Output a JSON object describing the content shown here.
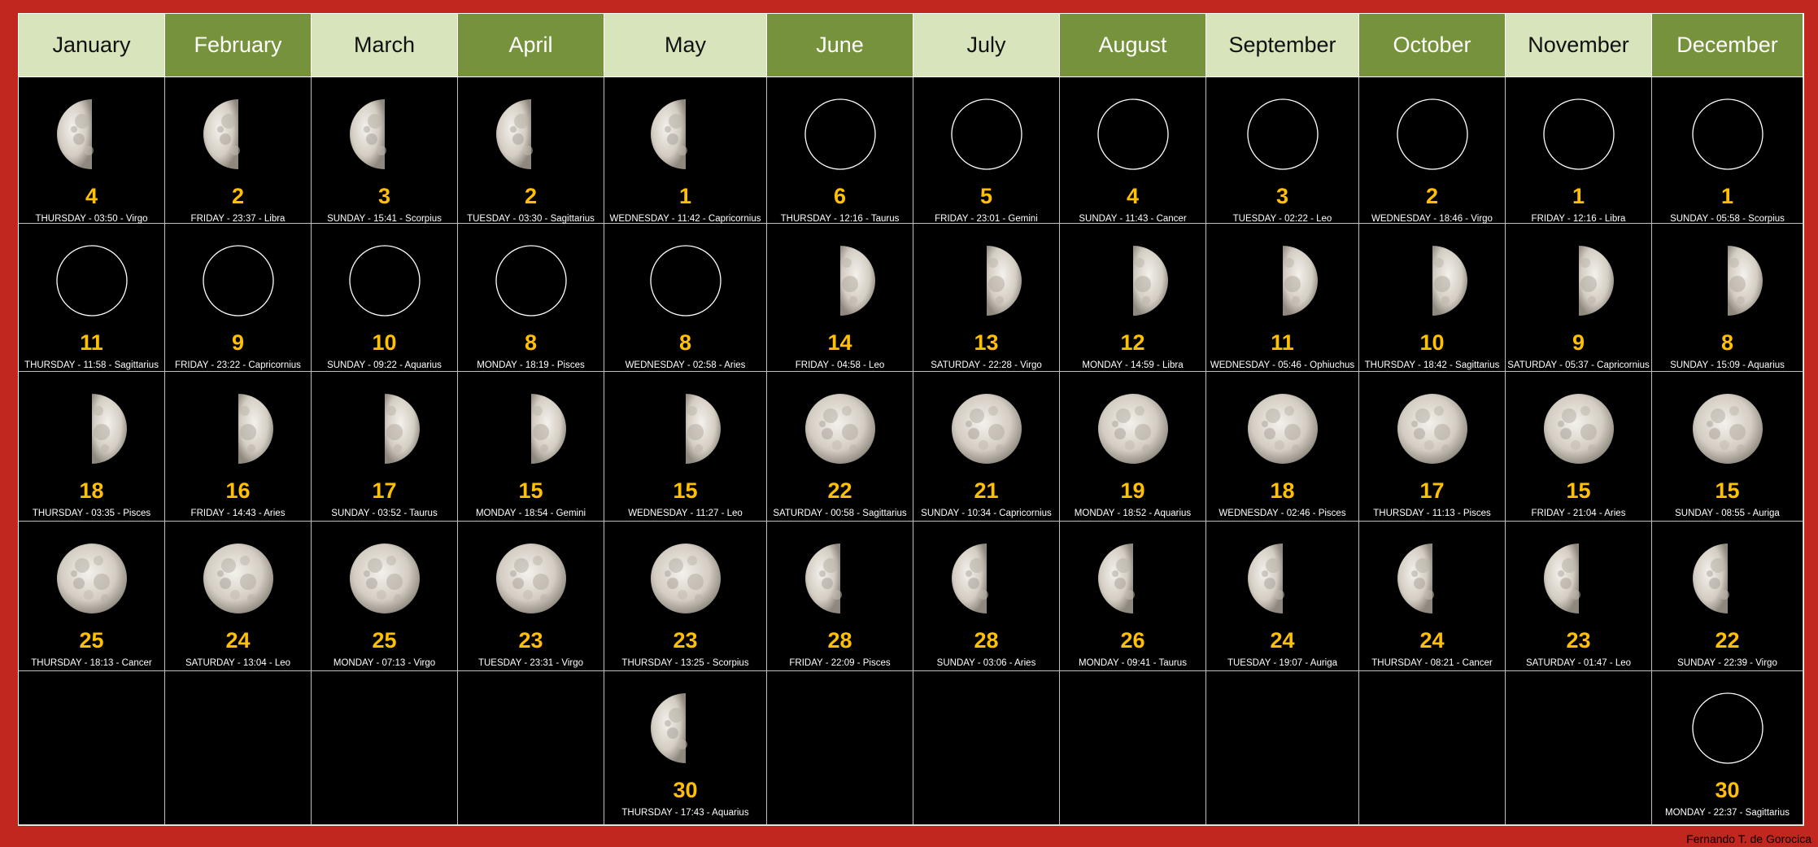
{
  "months": [
    "January",
    "February",
    "March",
    "April",
    "May",
    "June",
    "July",
    "August",
    "September",
    "October",
    "November",
    "December"
  ],
  "phases": {
    "first_quarter": "moon-first-quarter-icon",
    "new": "moon-new-icon",
    "last_quarter": "moon-last-quarter-icon",
    "full": "moon-full-icon"
  },
  "rows": [
    [
      {
        "phase": "first_quarter",
        "day": "4",
        "info": "THURSDAY - 03:50 - Virgo"
      },
      {
        "phase": "first_quarter",
        "day": "2",
        "info": "FRIDAY - 23:37 - Libra"
      },
      {
        "phase": "first_quarter",
        "day": "3",
        "info": "SUNDAY - 15:41 - Scorpius"
      },
      {
        "phase": "first_quarter",
        "day": "2",
        "info": "TUESDAY - 03:30 - Sagittarius"
      },
      {
        "phase": "first_quarter",
        "day": "1",
        "info": "WEDNESDAY - 11:42 - Capricornius"
      },
      {
        "phase": "new",
        "day": "6",
        "info": "THURSDAY - 12:16 - Taurus"
      },
      {
        "phase": "new",
        "day": "5",
        "info": "FRIDAY - 23:01 - Gemini"
      },
      {
        "phase": "new",
        "day": "4",
        "info": "SUNDAY - 11:43 - Cancer"
      },
      {
        "phase": "new",
        "day": "3",
        "info": "TUESDAY - 02:22 - Leo"
      },
      {
        "phase": "new",
        "day": "2",
        "info": "WEDNESDAY - 18:46 - Virgo"
      },
      {
        "phase": "new",
        "day": "1",
        "info": "FRIDAY - 12:16 - Libra"
      },
      {
        "phase": "new",
        "day": "1",
        "info": "SUNDAY - 05:58 - Scorpius"
      }
    ],
    [
      {
        "phase": "new",
        "day": "11",
        "info": "THURSDAY - 11:58 - Sagittarius"
      },
      {
        "phase": "new",
        "day": "9",
        "info": "FRIDAY - 23:22 - Capricornius"
      },
      {
        "phase": "new",
        "day": "10",
        "info": "SUNDAY - 09:22 - Aquarius"
      },
      {
        "phase": "new",
        "day": "8",
        "info": "MONDAY - 18:19 - Pisces"
      },
      {
        "phase": "new",
        "day": "8",
        "info": "WEDNESDAY - 02:58 - Aries"
      },
      {
        "phase": "last_quarter",
        "day": "14",
        "info": "FRIDAY - 04:58 - Leo"
      },
      {
        "phase": "last_quarter",
        "day": "13",
        "info": "SATURDAY - 22:28 - Virgo"
      },
      {
        "phase": "last_quarter",
        "day": "12",
        "info": "MONDAY - 14:59 - Libra"
      },
      {
        "phase": "last_quarter",
        "day": "11",
        "info": "WEDNESDAY - 05:46 - Ophiuchus"
      },
      {
        "phase": "last_quarter",
        "day": "10",
        "info": "THURSDAY - 18:42 - Sagittarius"
      },
      {
        "phase": "last_quarter",
        "day": "9",
        "info": "SATURDAY - 05:37 - Capricornius"
      },
      {
        "phase": "last_quarter",
        "day": "8",
        "info": "SUNDAY - 15:09 - Aquarius"
      }
    ],
    [
      {
        "phase": "last_quarter",
        "day": "18",
        "info": "THURSDAY - 03:35 - Pisces"
      },
      {
        "phase": "last_quarter",
        "day": "16",
        "info": "FRIDAY - 14:43 - Aries"
      },
      {
        "phase": "last_quarter",
        "day": "17",
        "info": "SUNDAY - 03:52 - Taurus"
      },
      {
        "phase": "last_quarter",
        "day": "15",
        "info": "MONDAY - 18:54 - Gemini"
      },
      {
        "phase": "last_quarter",
        "day": "15",
        "info": "WEDNESDAY - 11:27 - Leo"
      },
      {
        "phase": "full",
        "day": "22",
        "info": "SATURDAY - 00:58 - Sagittarius"
      },
      {
        "phase": "full",
        "day": "21",
        "info": "SUNDAY - 10:34 - Capricornius"
      },
      {
        "phase": "full",
        "day": "19",
        "info": "MONDAY - 18:52 - Aquarius"
      },
      {
        "phase": "full",
        "day": "18",
        "info": "WEDNESDAY - 02:46 - Pisces"
      },
      {
        "phase": "full",
        "day": "17",
        "info": "THURSDAY - 11:13 - Pisces"
      },
      {
        "phase": "full",
        "day": "15",
        "info": "FRIDAY - 21:04 - Aries"
      },
      {
        "phase": "full",
        "day": "15",
        "info": "SUNDAY - 08:55 - Auriga"
      }
    ],
    [
      {
        "phase": "full",
        "day": "25",
        "info": "THURSDAY - 18:13 - Cancer"
      },
      {
        "phase": "full",
        "day": "24",
        "info": "SATURDAY - 13:04 - Leo"
      },
      {
        "phase": "full",
        "day": "25",
        "info": "MONDAY - 07:13 - Virgo"
      },
      {
        "phase": "full",
        "day": "23",
        "info": "TUESDAY - 23:31 - Virgo"
      },
      {
        "phase": "full",
        "day": "23",
        "info": "THURSDAY - 13:25 - Scorpius"
      },
      {
        "phase": "first_quarter",
        "day": "28",
        "info": "FRIDAY - 22:09 - Pisces"
      },
      {
        "phase": "first_quarter",
        "day": "28",
        "info": "SUNDAY - 03:06 - Aries"
      },
      {
        "phase": "first_quarter",
        "day": "26",
        "info": "MONDAY - 09:41 - Taurus"
      },
      {
        "phase": "first_quarter",
        "day": "24",
        "info": "TUESDAY - 19:07 - Auriga"
      },
      {
        "phase": "first_quarter",
        "day": "24",
        "info": "THURSDAY - 08:21 - Cancer"
      },
      {
        "phase": "first_quarter",
        "day": "23",
        "info": "SATURDAY - 01:47 - Leo"
      },
      {
        "phase": "first_quarter",
        "day": "22",
        "info": "SUNDAY - 22:39 - Virgo"
      }
    ],
    [
      null,
      null,
      null,
      null,
      {
        "phase": "first_quarter",
        "day": "30",
        "info": "THURSDAY - 17:43 - Aquarius"
      },
      null,
      null,
      null,
      null,
      null,
      null,
      {
        "phase": "new",
        "day": "30",
        "info": "MONDAY - 22:37 - Sagittarius"
      }
    ]
  ],
  "colors": {
    "frame": "#c1261f",
    "header_light": "#d7e4bc",
    "header_dark": "#76923c",
    "day_number": "#ffc000",
    "grid": "#bfbfbf"
  },
  "credit": "Fernando T. de Gorocica"
}
